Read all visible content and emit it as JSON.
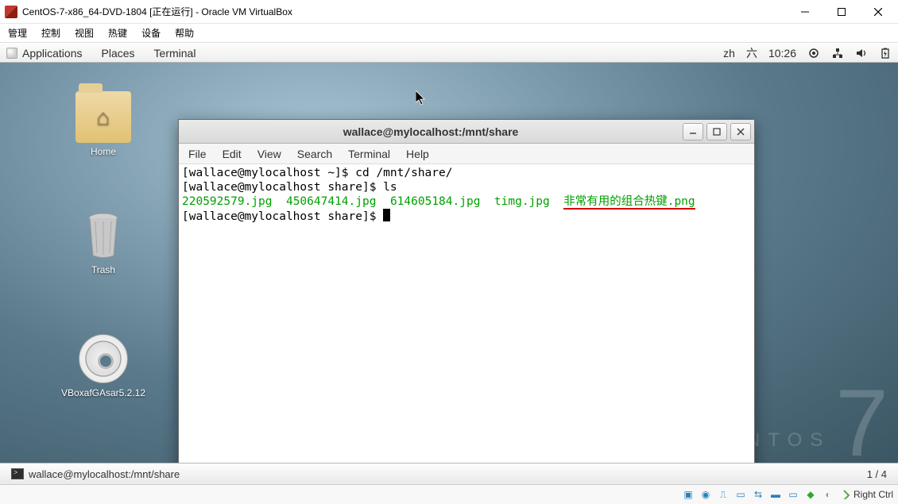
{
  "vb": {
    "title": "CentOS-7-x86_64-DVD-1804 [正在运行] - Oracle VM VirtualBox",
    "menu": [
      "管理",
      "控制",
      "视图",
      "热键",
      "设备",
      "帮助"
    ],
    "status": {
      "hostkey": "Right Ctrl"
    }
  },
  "gnome_panel": {
    "left": [
      "Applications",
      "Places",
      "Terminal"
    ],
    "right": {
      "lang": "zh",
      "day": "六",
      "time": "10:26"
    }
  },
  "desktop_icons": {
    "home": "Home",
    "trash": "Trash",
    "cd": "VBoxafGAsar5.2.12"
  },
  "taskbar": {
    "task": "wallace@mylocalhost:/mnt/share",
    "workspace": "1 / 4"
  },
  "terminal": {
    "title": "wallace@mylocalhost:/mnt/share",
    "menu": [
      "File",
      "Edit",
      "View",
      "Search",
      "Terminal",
      "Help"
    ],
    "lines": {
      "l1_prompt": "[wallace@mylocalhost ~]$ ",
      "l1_cmd": "cd /mnt/share/",
      "l2_prompt": "[wallace@mylocalhost share]$ ",
      "l2_cmd": "ls",
      "files": {
        "f1": "220592579.jpg",
        "f2": "450647414.jpg",
        "f3": "614605184.jpg",
        "f4": "timg.jpg",
        "f5": "非常有用的组合热键.png"
      },
      "l4_prompt": "[wallace@mylocalhost share]$ "
    }
  }
}
